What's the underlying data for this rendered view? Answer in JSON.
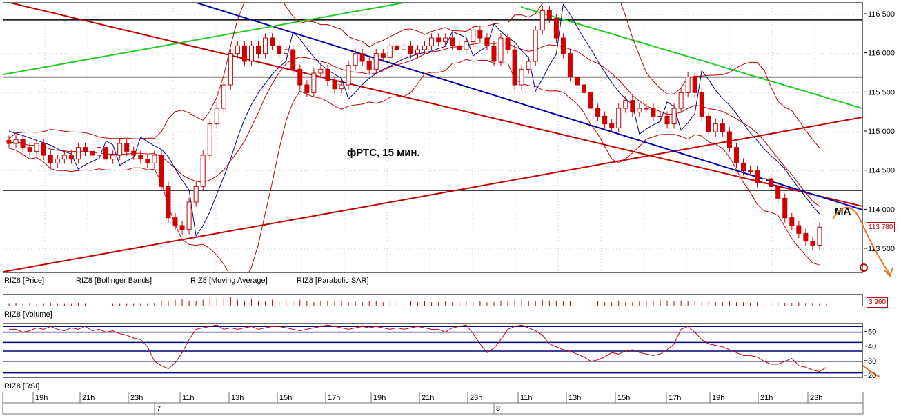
{
  "chart_data": [
    {
      "type": "candlestick",
      "title": "",
      "annotation": "фРТС, 15 мин.",
      "ma_label": "MA",
      "y_ticks": [
        116500,
        116000,
        115500,
        115000,
        114500,
        114000,
        113500
      ],
      "y_tick_labels": [
        "116 500",
        "116 000",
        "115 500",
        "115 000",
        "114 500",
        "114 000",
        "113 500"
      ],
      "ylim": [
        113200,
        116650
      ],
      "last_price_label": "113 780",
      "last_price": 113780,
      "horizontal_levels": [
        116430,
        115700,
        114250
      ],
      "legend": [
        {
          "label": "RIZ8 [Price]",
          "color": "#000000"
        },
        {
          "label": "RIZ8 [Bollinger Bands]",
          "color": "#c00000"
        },
        {
          "label": "RIZ8 [Moving Average]",
          "color": "#c00000"
        },
        {
          "label": "RIZ8 [Parabolic SAR]",
          "color": "#00008b"
        }
      ],
      "close_series": [
        114850,
        114900,
        114800,
        114750,
        114850,
        114700,
        114600,
        114650,
        114700,
        114650,
        114800,
        114750,
        114700,
        114800,
        114650,
        114700,
        114850,
        114750,
        114700,
        114650,
        114600,
        114700,
        114300,
        113900,
        113800,
        113750,
        114100,
        114300,
        114700,
        115100,
        115300,
        115600,
        116000,
        116100,
        115900,
        116100,
        116000,
        116200,
        116100,
        116000,
        116050,
        115800,
        115600,
        115500,
        115750,
        115800,
        115650,
        115550,
        115600,
        115850,
        116000,
        115900,
        115800,
        116000,
        115950,
        116100,
        116050,
        116100,
        116000,
        116050,
        116100,
        116200,
        116150,
        116200,
        116100,
        116050,
        116150,
        116300,
        116200,
        116100,
        115900,
        116200,
        116050,
        115600,
        115800,
        115900,
        116300,
        116550,
        116450,
        116200,
        116000,
        115700,
        115600,
        115500,
        115300,
        115200,
        115100,
        115050,
        115300,
        115400,
        115250,
        115300,
        115300,
        115200,
        115200,
        115100,
        115300,
        115500,
        115700,
        115500,
        115200,
        115000,
        115100,
        115000,
        114800,
        114600,
        114500,
        114500,
        114350,
        114400,
        114300,
        114150,
        113900,
        113800,
        113700,
        113600,
        113550,
        113780
      ],
      "rsi_ticks": [
        50,
        40,
        30,
        20
      ],
      "rsi_levels": [
        54,
        50,
        43,
        37,
        30,
        22
      ],
      "rsi_series": [
        52,
        52,
        50,
        51,
        53,
        52,
        54,
        52,
        51,
        53,
        52,
        54,
        51,
        52,
        50,
        51,
        49,
        48,
        46,
        45,
        40,
        30,
        27,
        25,
        29,
        36,
        45,
        52,
        53,
        54,
        55,
        52,
        53,
        52,
        53,
        54,
        52,
        53,
        54,
        54,
        53,
        52,
        51,
        52,
        53,
        54,
        55,
        54,
        53,
        52,
        53,
        54,
        53,
        54,
        53,
        52,
        53,
        52,
        53,
        54,
        53,
        52,
        52,
        50,
        53,
        54,
        55,
        49,
        42,
        36,
        39,
        45,
        52,
        54,
        55,
        53,
        51,
        48,
        42,
        40,
        38,
        37,
        35,
        33,
        30,
        31,
        33,
        36,
        35,
        37,
        38,
        36,
        35,
        34,
        35,
        38,
        42,
        52,
        54,
        50,
        45,
        42,
        41,
        40,
        38,
        36,
        34,
        34,
        33,
        30,
        28,
        28,
        30,
        32,
        27,
        26,
        24,
        23,
        26
      ],
      "volume_label": "3 960",
      "volume_series": [
        2,
        3,
        2,
        3,
        2,
        2,
        3,
        2,
        2,
        2,
        3,
        2,
        2,
        2,
        3,
        2,
        2,
        2,
        2,
        2,
        2,
        3,
        6,
        5,
        7,
        8,
        6,
        6,
        7,
        9,
        8,
        9,
        10,
        7,
        6,
        8,
        6,
        5,
        7,
        6,
        6,
        5,
        7,
        5,
        4,
        5,
        6,
        5,
        6,
        4,
        5,
        4,
        5,
        5,
        4,
        5,
        4,
        4,
        5,
        4,
        5,
        4,
        4,
        5,
        4,
        4,
        5,
        4,
        5,
        4,
        4,
        6,
        5,
        7,
        8,
        6,
        5,
        7,
        6,
        6,
        5,
        5,
        4,
        5,
        4,
        5,
        4,
        4,
        5,
        4,
        4,
        5,
        5,
        6,
        7,
        6,
        5,
        6,
        5,
        5,
        4,
        5,
        4,
        4,
        5,
        4,
        4,
        3,
        4,
        3,
        3,
        4,
        3,
        3,
        4,
        3,
        3,
        2,
        2
      ],
      "pane_labels": {
        "volume": "RIZ8 [Volume]",
        "rsi": "RIZ8 [RSI]"
      },
      "time_ticks": [
        "19h",
        "21h",
        "23h",
        "7",
        "11h",
        "13h",
        "15h",
        "17h",
        "19h",
        "21h",
        "23h",
        "8",
        "11h",
        "13h",
        "15h",
        "17h",
        "19h",
        "21h",
        "23h"
      ],
      "hour_labels": [
        "19h",
        "21h",
        "23h",
        "11h",
        "13h",
        "15h",
        "17h",
        "19h",
        "21h",
        "23h",
        "11h",
        "13h",
        "15h",
        "17h",
        "19h",
        "21h",
        "23h"
      ],
      "day_labels": [
        "7",
        "8"
      ]
    }
  ]
}
